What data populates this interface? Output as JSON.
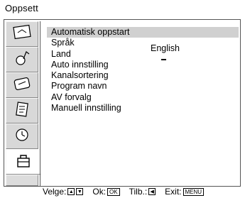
{
  "header": {
    "title": "Oppsett"
  },
  "sidebar": {
    "tabs": [
      {
        "icon": "picture-icon"
      },
      {
        "icon": "sound-icon"
      },
      {
        "icon": "screen-icon"
      },
      {
        "icon": "features-icon"
      },
      {
        "icon": "timer-icon"
      },
      {
        "icon": "setup-toolbox-icon"
      },
      {
        "icon": "empty-tab"
      }
    ]
  },
  "menu": {
    "items": [
      {
        "label": "Automatisk oppstart"
      },
      {
        "label": "Språk"
      },
      {
        "label": "Land"
      },
      {
        "label": "Auto innstilling"
      },
      {
        "label": "Kanalsortering"
      },
      {
        "label": "Program navn"
      },
      {
        "label": "AV forvalg"
      },
      {
        "label": "Manuell innstilling"
      }
    ],
    "language_value": "English"
  },
  "footer": {
    "select_label": "Velge:",
    "ok_label": "Ok:",
    "ok_key": "OK",
    "back_label": "Tilb.:",
    "exit_label": "Exit:",
    "menu_key": "MENU"
  }
}
